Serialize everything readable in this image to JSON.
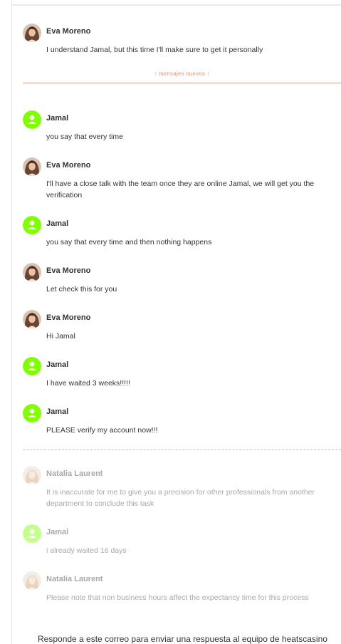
{
  "new_messages_label": "↑ mensajes nuevos ↑",
  "colors": {
    "jamal_avatar": "#7fff00",
    "new_separator": "#e7a58c",
    "faded_text": "#a9a9a9"
  },
  "messages_before": [
    {
      "author": "Eva Moreno",
      "avatar": "woman-brunette-avatar",
      "text": "I understand Jamal, but this time I'll make sure to get it personally"
    }
  ],
  "messages_new": [
    {
      "author": "Jamal",
      "avatar": "user-icon",
      "text": "you say that every time"
    },
    {
      "author": "Eva Moreno",
      "avatar": "woman-brunette-avatar",
      "text": "I'll have a close talk with the team once they are online Jamal, we will get you the verification"
    },
    {
      "author": "Jamal",
      "avatar": "user-icon",
      "text": "you say that every time and then nothing happens"
    },
    {
      "author": "Eva Moreno",
      "avatar": "woman-brunette-avatar",
      "text": "Let check this for you"
    },
    {
      "author": "Eva Moreno",
      "avatar": "woman-brunette-avatar",
      "text": "Hi Jamal"
    },
    {
      "author": "Jamal",
      "avatar": "user-icon",
      "text": "I have waited 3 weeks!!!!!"
    },
    {
      "author": "Jamal",
      "avatar": "user-icon",
      "text": "PLEASE verify my account now!!!"
    }
  ],
  "messages_faded": [
    {
      "author": "Natalia Laurent",
      "avatar": "woman-blonde-avatar",
      "text": "It is inaccurate for me to give you a precision for other professionals from another department to conclude this task"
    },
    {
      "author": "Jamal",
      "avatar": "user-icon",
      "text": "i already waited 16 days"
    },
    {
      "author": "Natalia Laurent",
      "avatar": "woman-blonde-avatar",
      "text": "Please note that non business hours affect the expectancy time for this process"
    }
  ],
  "footer_text": "Responde a este correo para enviar una respuesta al equipo de heatscasino"
}
